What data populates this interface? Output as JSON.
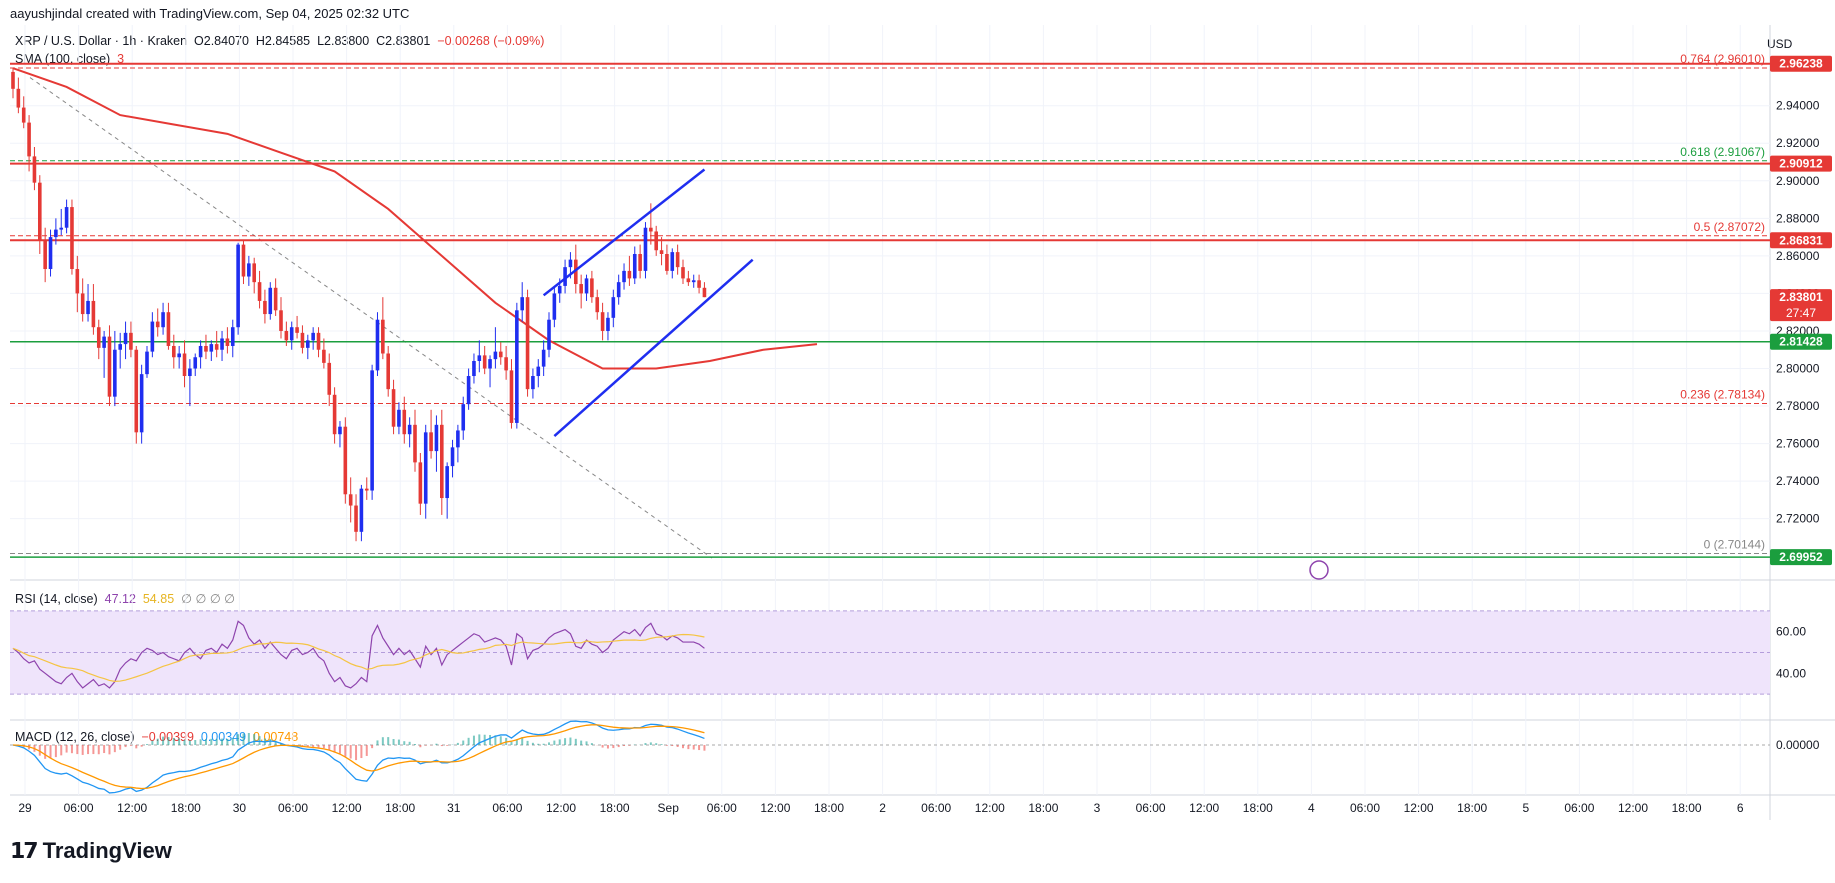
{
  "header": {
    "created_by": "aayushjindal created with TradingView.com, Sep 04, 2025 02:32 UTC",
    "symbol": "XRP / U.S. Dollar · 1h · Kraken",
    "ohlc": {
      "o": "O2.84070",
      "h": "H2.84585",
      "l": "L2.83800",
      "c": "C2.83801",
      "chg": "−0.00268 (−0.09%)"
    },
    "sma_label": "SMA (100, close)",
    "sma_extra": "3",
    "currency": "USD"
  },
  "rsi_legend": {
    "label": "RSI (14, close)",
    "v1": "47.12",
    "v2": "54.85",
    "extra": "∅ ∅ ∅ ∅"
  },
  "macd_legend": {
    "label": "MACD (12, 26, close)",
    "v1": "−0.00399",
    "v2": "0.00349",
    "v3": "0.00748"
  },
  "footer": {
    "brand": "TradingView"
  },
  "colors": {
    "up": "#1f2ef0",
    "down": "#e53935",
    "sma": "#e53935",
    "support": "#1b9e3e",
    "resistance": "#e53935",
    "channel": "#1f2ef0",
    "rsi": "#8e44ad",
    "rsi_ma": "#f5c443",
    "macd": "#2196f3",
    "signal": "#ff9800"
  },
  "chart_data": {
    "type": "candlestick",
    "price_axis": {
      "min": 2.69,
      "max": 2.975,
      "ticks": [
        "2.94000",
        "2.92000",
        "2.90000",
        "2.88000",
        "2.86000",
        "2.84000",
        "2.82000",
        "2.80000",
        "2.78000",
        "2.76000",
        "2.74000",
        "2.72000"
      ]
    },
    "time_axis": [
      "29",
      "06:00",
      "12:00",
      "18:00",
      "30",
      "06:00",
      "12:00",
      "18:00",
      "31",
      "06:00",
      "12:00",
      "18:00",
      "Sep",
      "06:00",
      "12:00",
      "18:00",
      "2",
      "06:00",
      "12:00",
      "18:00",
      "3",
      "06:00",
      "12:00",
      "18:00",
      "4",
      "06:00",
      "12:00",
      "18:00",
      "5",
      "06:00",
      "12:00",
      "18:00",
      "6"
    ],
    "candles": [
      [
        2.958,
        2.96,
        2.944,
        2.949
      ],
      [
        2.949,
        2.955,
        2.936,
        2.939
      ],
      [
        2.939,
        2.945,
        2.928,
        2.931
      ],
      [
        2.931,
        2.935,
        2.905,
        2.913
      ],
      [
        2.913,
        2.918,
        2.895,
        2.899
      ],
      [
        2.899,
        2.903,
        2.861,
        2.868
      ],
      [
        2.868,
        2.875,
        2.846,
        2.853
      ],
      [
        2.853,
        2.874,
        2.849,
        2.87
      ],
      [
        2.87,
        2.88,
        2.866,
        2.874
      ],
      [
        2.874,
        2.885,
        2.871,
        2.875
      ],
      [
        2.875,
        2.89,
        2.872,
        2.886
      ],
      [
        2.886,
        2.89,
        2.85,
        2.853
      ],
      [
        2.853,
        2.86,
        2.83,
        2.84
      ],
      [
        2.84,
        2.848,
        2.825,
        2.829
      ],
      [
        2.829,
        2.845,
        2.825,
        2.836
      ],
      [
        2.836,
        2.845,
        2.818,
        2.822
      ],
      [
        2.822,
        2.826,
        2.805,
        2.811
      ],
      [
        2.811,
        2.82,
        2.795,
        2.817
      ],
      [
        2.817,
        2.823,
        2.78,
        2.785
      ],
      [
        2.785,
        2.82,
        2.78,
        2.81
      ],
      [
        2.81,
        2.819,
        2.8,
        2.813
      ],
      [
        2.813,
        2.825,
        2.805,
        2.819
      ],
      [
        2.819,
        2.825,
        2.806,
        2.81
      ],
      [
        2.81,
        2.812,
        2.76,
        2.766
      ],
      [
        2.766,
        2.802,
        2.76,
        2.797
      ],
      [
        2.797,
        2.812,
        2.795,
        2.809
      ],
      [
        2.809,
        2.83,
        2.806,
        2.825
      ],
      [
        2.825,
        2.832,
        2.817,
        2.822
      ],
      [
        2.822,
        2.835,
        2.818,
        2.83
      ],
      [
        2.83,
        2.835,
        2.81,
        2.812
      ],
      [
        2.812,
        2.818,
        2.8,
        2.806
      ],
      [
        2.806,
        2.812,
        2.8,
        2.808
      ],
      [
        2.808,
        2.815,
        2.79,
        2.796
      ],
      [
        2.796,
        2.805,
        2.78,
        2.8
      ],
      [
        2.8,
        2.808,
        2.796,
        2.806
      ],
      [
        2.806,
        2.815,
        2.8,
        2.812
      ],
      [
        2.812,
        2.818,
        2.805,
        2.809
      ],
      [
        2.809,
        2.815,
        2.804,
        2.813
      ],
      [
        2.813,
        2.82,
        2.806,
        2.81
      ],
      [
        2.81,
        2.82,
        2.804,
        2.816
      ],
      [
        2.816,
        2.822,
        2.808,
        2.812
      ],
      [
        2.812,
        2.826,
        2.806,
        2.822
      ],
      [
        2.822,
        2.867,
        2.818,
        2.866
      ],
      [
        2.866,
        2.868,
        2.845,
        2.849
      ],
      [
        2.849,
        2.86,
        2.844,
        2.856
      ],
      [
        2.856,
        2.859,
        2.84,
        2.846
      ],
      [
        2.846,
        2.852,
        2.832,
        2.836
      ],
      [
        2.836,
        2.842,
        2.824,
        2.829
      ],
      [
        2.829,
        2.846,
        2.826,
        2.843
      ],
      [
        2.843,
        2.848,
        2.828,
        2.831
      ],
      [
        2.831,
        2.838,
        2.816,
        2.82
      ],
      [
        2.82,
        2.825,
        2.812,
        2.815
      ],
      [
        2.815,
        2.825,
        2.81,
        2.822
      ],
      [
        2.822,
        2.828,
        2.816,
        2.819
      ],
      [
        2.819,
        2.823,
        2.808,
        2.811
      ],
      [
        2.811,
        2.818,
        2.805,
        2.815
      ],
      [
        2.815,
        2.822,
        2.81,
        2.819
      ],
      [
        2.819,
        2.822,
        2.806,
        2.81
      ],
      [
        2.81,
        2.816,
        2.8,
        2.803
      ],
      [
        2.803,
        2.808,
        2.78,
        2.786
      ],
      [
        2.786,
        2.79,
        2.76,
        2.765
      ],
      [
        2.765,
        2.772,
        2.758,
        2.769
      ],
      [
        2.769,
        2.774,
        2.728,
        2.733
      ],
      [
        2.733,
        2.742,
        2.718,
        2.727
      ],
      [
        2.727,
        2.733,
        2.708,
        2.713
      ],
      [
        2.713,
        2.738,
        2.708,
        2.736
      ],
      [
        2.736,
        2.742,
        2.73,
        2.735
      ],
      [
        2.735,
        2.802,
        2.73,
        2.799
      ],
      [
        2.799,
        2.83,
        2.796,
        2.826
      ],
      [
        2.826,
        2.838,
        2.805,
        2.808
      ],
      [
        2.808,
        2.812,
        2.785,
        2.789
      ],
      [
        2.789,
        2.794,
        2.765,
        2.769
      ],
      [
        2.769,
        2.782,
        2.765,
        2.778
      ],
      [
        2.778,
        2.785,
        2.76,
        2.765
      ],
      [
        2.765,
        2.774,
        2.758,
        2.77
      ],
      [
        2.77,
        2.778,
        2.745,
        2.75
      ],
      [
        2.75,
        2.755,
        2.722,
        2.728
      ],
      [
        2.728,
        2.77,
        2.72,
        2.766
      ],
      [
        2.766,
        2.778,
        2.752,
        2.756
      ],
      [
        2.756,
        2.775,
        2.745,
        2.77
      ],
      [
        2.77,
        2.778,
        2.722,
        2.731
      ],
      [
        2.731,
        2.75,
        2.72,
        2.748
      ],
      [
        2.748,
        2.762,
        2.742,
        2.758
      ],
      [
        2.758,
        2.77,
        2.75,
        2.767
      ],
      [
        2.767,
        2.785,
        2.762,
        2.781
      ],
      [
        2.781,
        2.8,
        2.778,
        2.796
      ],
      [
        2.796,
        2.808,
        2.792,
        2.804
      ],
      [
        2.804,
        2.815,
        2.798,
        2.807
      ],
      [
        2.807,
        2.812,
        2.797,
        2.8
      ],
      [
        2.8,
        2.807,
        2.79,
        2.805
      ],
      [
        2.805,
        2.822,
        2.8,
        2.809
      ],
      [
        2.809,
        2.814,
        2.802,
        2.806
      ],
      [
        2.806,
        2.812,
        2.794,
        2.799
      ],
      [
        2.799,
        2.805,
        2.768,
        2.771
      ],
      [
        2.771,
        2.835,
        2.768,
        2.831
      ],
      [
        2.831,
        2.846,
        2.825,
        2.838
      ],
      [
        2.838,
        2.842,
        2.785,
        2.789
      ],
      [
        2.789,
        2.8,
        2.784,
        2.796
      ],
      [
        2.796,
        2.805,
        2.79,
        2.801
      ],
      [
        2.801,
        2.815,
        2.796,
        2.81
      ],
      [
        2.81,
        2.83,
        2.806,
        2.826
      ],
      [
        2.826,
        2.844,
        2.822,
        2.84
      ],
      [
        2.84,
        2.848,
        2.835,
        2.844
      ],
      [
        2.844,
        2.858,
        2.84,
        2.854
      ],
      [
        2.854,
        2.862,
        2.848,
        2.858
      ],
      [
        2.858,
        2.866,
        2.84,
        2.845
      ],
      [
        2.845,
        2.85,
        2.832,
        2.84
      ],
      [
        2.84,
        2.85,
        2.836,
        2.848
      ],
      [
        2.848,
        2.852,
        2.835,
        2.838
      ],
      [
        2.838,
        2.842,
        2.826,
        2.83
      ],
      [
        2.83,
        2.835,
        2.815,
        2.82
      ],
      [
        2.82,
        2.83,
        2.815,
        2.827
      ],
      [
        2.827,
        2.842,
        2.822,
        2.838
      ],
      [
        2.838,
        2.85,
        2.834,
        2.846
      ],
      [
        2.846,
        2.856,
        2.842,
        2.852
      ],
      [
        2.852,
        2.86,
        2.844,
        2.848
      ],
      [
        2.848,
        2.865,
        2.845,
        2.861
      ],
      [
        2.861,
        2.866,
        2.848,
        2.852
      ],
      [
        2.852,
        2.878,
        2.848,
        2.875
      ],
      [
        2.875,
        2.888,
        2.866,
        2.873
      ],
      [
        2.873,
        2.876,
        2.86,
        2.863
      ],
      [
        2.863,
        2.87,
        2.855,
        2.861
      ],
      [
        2.861,
        2.866,
        2.85,
        2.852
      ],
      [
        2.852,
        2.864,
        2.848,
        2.862
      ],
      [
        2.862,
        2.866,
        2.85,
        2.854
      ],
      [
        2.854,
        2.858,
        2.845,
        2.848
      ],
      [
        2.848,
        2.852,
        2.844,
        2.846
      ],
      [
        2.846,
        2.85,
        2.843,
        2.847
      ],
      [
        2.847,
        2.85,
        2.84,
        2.843
      ],
      [
        2.843,
        2.846,
        2.838,
        2.838
      ]
    ],
    "sma100": [
      [
        0,
        2.96
      ],
      [
        10,
        2.95
      ],
      [
        20,
        2.935
      ],
      [
        30,
        2.93
      ],
      [
        40,
        2.925
      ],
      [
        50,
        2.915
      ],
      [
        60,
        2.905
      ],
      [
        70,
        2.885
      ],
      [
        80,
        2.86
      ],
      [
        90,
        2.835
      ],
      [
        100,
        2.815
      ],
      [
        110,
        2.8
      ],
      [
        120,
        2.8
      ],
      [
        130,
        2.804
      ],
      [
        140,
        2.81
      ],
      [
        150,
        2.813
      ]
    ],
    "levels": [
      {
        "price": 2.96238,
        "label": "2.96238",
        "style": "solid",
        "color": "red"
      },
      {
        "price": 2.90912,
        "label": "2.90912",
        "style": "solid",
        "color": "red"
      },
      {
        "price": 2.86831,
        "label": "2.86831",
        "style": "solid",
        "color": "red"
      },
      {
        "price": 2.81428,
        "label": "2.81428",
        "style": "solid",
        "color": "green"
      },
      {
        "price": 2.69952,
        "label": "2.69952",
        "style": "solid",
        "color": "green"
      },
      {
        "price": 2.83801,
        "label": "2.83801",
        "sub": "27:47",
        "style": "current",
        "color": "red"
      }
    ],
    "fib": [
      {
        "price": 2.9601,
        "label": "0.764 (2.96010)",
        "color": "red"
      },
      {
        "price": 2.91067,
        "label": "0.618 (2.91067)",
        "color": "green"
      },
      {
        "price": 2.87072,
        "label": "0.5 (2.87072)",
        "color": "red"
      },
      {
        "price": 2.78134,
        "label": "0.236 (2.78134)",
        "color": "red"
      },
      {
        "price": 2.70144,
        "label": "0 (2.70144)",
        "color": "gray"
      }
    ],
    "channel": {
      "upper": [
        [
          99,
          2.839
        ],
        [
          129,
          2.906
        ]
      ],
      "lower": [
        [
          101,
          2.764
        ],
        [
          138,
          2.858
        ]
      ]
    },
    "rsi_axis": [
      "60.00",
      "40.00"
    ],
    "macd_axis": [
      "0.00000"
    ],
    "rsi": [
      52,
      50,
      47,
      45,
      46,
      42,
      40,
      38,
      36,
      35,
      38,
      40,
      36,
      33,
      35,
      37,
      34,
      35,
      33,
      36,
      42,
      45,
      47,
      46,
      50,
      52,
      51,
      49,
      50,
      48,
      47,
      46,
      50,
      52,
      49,
      47,
      51,
      52,
      50,
      54,
      52,
      56,
      65,
      63,
      57,
      54,
      56,
      52,
      55,
      52,
      49,
      47,
      51,
      52,
      49,
      50,
      52,
      48,
      46,
      40,
      36,
      38,
      34,
      33,
      35,
      38,
      36,
      58,
      63,
      57,
      53,
      49,
      52,
      49,
      51,
      47,
      43,
      53,
      49,
      52,
      44,
      49,
      51,
      53,
      55,
      57,
      59,
      58,
      55,
      56,
      57,
      56,
      53,
      44,
      59,
      57,
      47,
      51,
      52,
      54,
      57,
      59,
      60,
      61,
      59,
      53,
      52,
      56,
      54,
      53,
      50,
      52,
      56,
      58,
      60,
      59,
      61,
      58,
      62,
      64,
      59,
      58,
      56,
      58,
      57,
      55,
      55,
      55,
      54,
      52
    ]
  }
}
